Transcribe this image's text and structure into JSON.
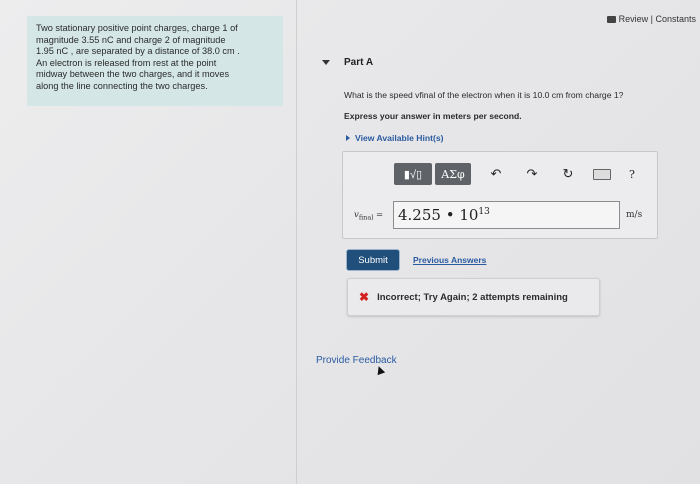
{
  "problem": {
    "lines": [
      "Two stationary positive point charges, charge 1 of",
      "magnitude 3.55 nC and charge 2 of magnitude",
      "1.95 nC , are separated by a distance of 38.0 cm .",
      "An electron is released from rest at the point",
      "midway between the two charges, and it moves",
      "along the line connecting the two charges."
    ]
  },
  "header": {
    "review_label": "Review | Constants"
  },
  "part": {
    "title": "Part A"
  },
  "question": "What is the speed vfinal of the electron when it is 10.0 cm from charge 1?",
  "instruction": "Express your answer in meters per second.",
  "hint_label": "View Available Hint(s)",
  "toolbar": {
    "template_label": "▮√▯",
    "greek_label": "ΑΣφ",
    "undo_icon": "↶",
    "redo_icon": "↷",
    "reset_icon": "↻",
    "help_label": "?"
  },
  "answer": {
    "variable": "v",
    "variable_sub": "final",
    "equals": "=",
    "value_mantissa": "4.255 • 10",
    "value_exponent": "13",
    "unit": "m/s"
  },
  "submit_label": "Submit",
  "previous_answers_label": "Previous Answers",
  "feedback": {
    "icon": "✖",
    "message": "Incorrect; Try Again; 2 attempts remaining",
    "icon_color": "#d32020"
  },
  "provide_feedback_label": "Provide Feedback"
}
